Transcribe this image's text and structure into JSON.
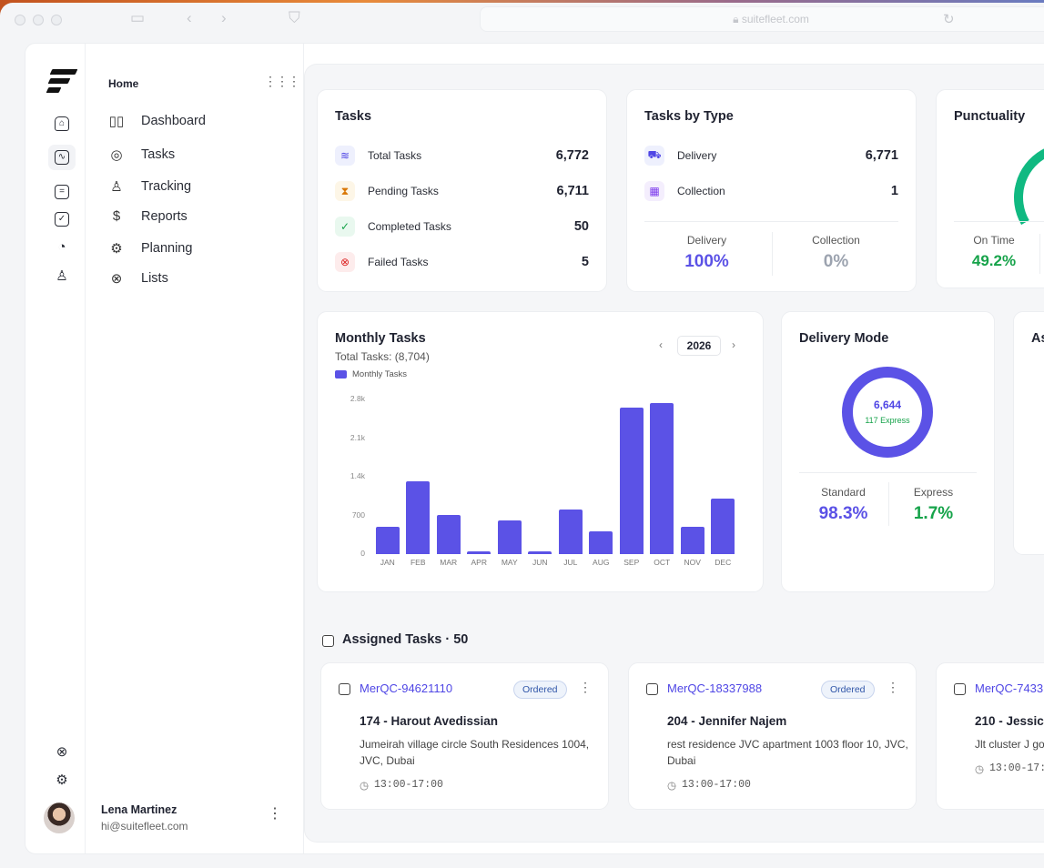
{
  "browser": {
    "url": "suitefleet.com"
  },
  "sidebar": {
    "home": "Home",
    "nav": [
      {
        "label": "Dashboard",
        "icon": "dashboard-icon"
      },
      {
        "label": "Tasks",
        "icon": "target-icon"
      },
      {
        "label": "Tracking",
        "icon": "user-icon"
      },
      {
        "label": "Reports",
        "icon": "dollar-doc-icon"
      },
      {
        "label": "Planning",
        "icon": "gear-icon"
      },
      {
        "label": "Lists",
        "icon": "lifebuoy-icon"
      }
    ],
    "user": {
      "name": "Lena Martinez",
      "email": "hi@suitefleet.com"
    }
  },
  "tasks_card": {
    "title": "Tasks",
    "rows": [
      {
        "label": "Total Tasks",
        "value": "6,772",
        "icon": "layers-icon",
        "color": "#4f46e5"
      },
      {
        "label": "Pending Tasks",
        "value": "6,711",
        "icon": "hourglass-icon",
        "color": "#d97706"
      },
      {
        "label": "Completed Tasks",
        "value": "50",
        "icon": "check-circle-icon",
        "color": "#16a34a"
      },
      {
        "label": "Failed Tasks",
        "value": "5",
        "icon": "x-circle-icon",
        "color": "#dc2626"
      }
    ]
  },
  "type_card": {
    "title": "Tasks by Type",
    "rows": [
      {
        "label": "Delivery",
        "value": "6,771",
        "icon": "truck-icon"
      },
      {
        "label": "Collection",
        "value": "1",
        "icon": "grid-icon"
      }
    ],
    "stats": [
      {
        "label": "Delivery",
        "value": "100%",
        "color": "#5b52e6"
      },
      {
        "label": "Collection",
        "value": "0%",
        "color": "#9ca3af"
      }
    ]
  },
  "punctuality_card": {
    "title": "Punctuality",
    "stats": [
      {
        "label": "On Time",
        "value": "49.2%",
        "color": "#16a34a"
      }
    ]
  },
  "monthly": {
    "title": "Monthly Tasks",
    "subtitle": "Total Tasks: (8,704)",
    "legend": "Monthly Tasks",
    "year": "2026"
  },
  "chart_data": {
    "type": "bar",
    "categories": [
      "JAN",
      "FEB",
      "MAR",
      "APR",
      "MAY",
      "JUN",
      "JUL",
      "AUG",
      "SEP",
      "OCT",
      "NOV",
      "DEC"
    ],
    "series": [
      {
        "name": "Monthly Tasks",
        "values": [
          500,
          1320,
          710,
          50,
          610,
          50,
          810,
          410,
          2660,
          2740,
          500,
          1010
        ]
      }
    ],
    "yticks": [
      "2.8k",
      "2.1k",
      "1.4k",
      "700",
      "0"
    ],
    "ylim": [
      0,
      2800
    ],
    "color": "#5b52e6"
  },
  "delivery_mode": {
    "title": "Delivery Mode",
    "total": "6,644",
    "express_count": "117 Express",
    "stats": [
      {
        "label": "Standard",
        "value": "98.3%",
        "color": "#5b52e6"
      },
      {
        "label": "Express",
        "value": "1.7%",
        "color": "#16a34a"
      }
    ]
  },
  "partial_card": {
    "title_fragment": "As"
  },
  "assigned": {
    "title": "Assigned Tasks · 50",
    "cards": [
      {
        "id": "MerQC-94621110",
        "status": "Ordered",
        "name": "174 - Harout Avedissian",
        "address": "Jumeirah village circle South Residences 1004, JVC, Dubai",
        "time": "13:00-17:00"
      },
      {
        "id": "MerQC-18337988",
        "status": "Ordered",
        "name": "204 - Jennifer Najem",
        "address": "rest residence JVC apartment 1003 floor 10, JVC, Dubai",
        "time": "13:00-17:00"
      },
      {
        "id": "MerQC-7433",
        "status": "",
        "name": "210 - Jessic",
        "address": "Jlt cluster J go",
        "time": "13:00-17:"
      }
    ]
  }
}
